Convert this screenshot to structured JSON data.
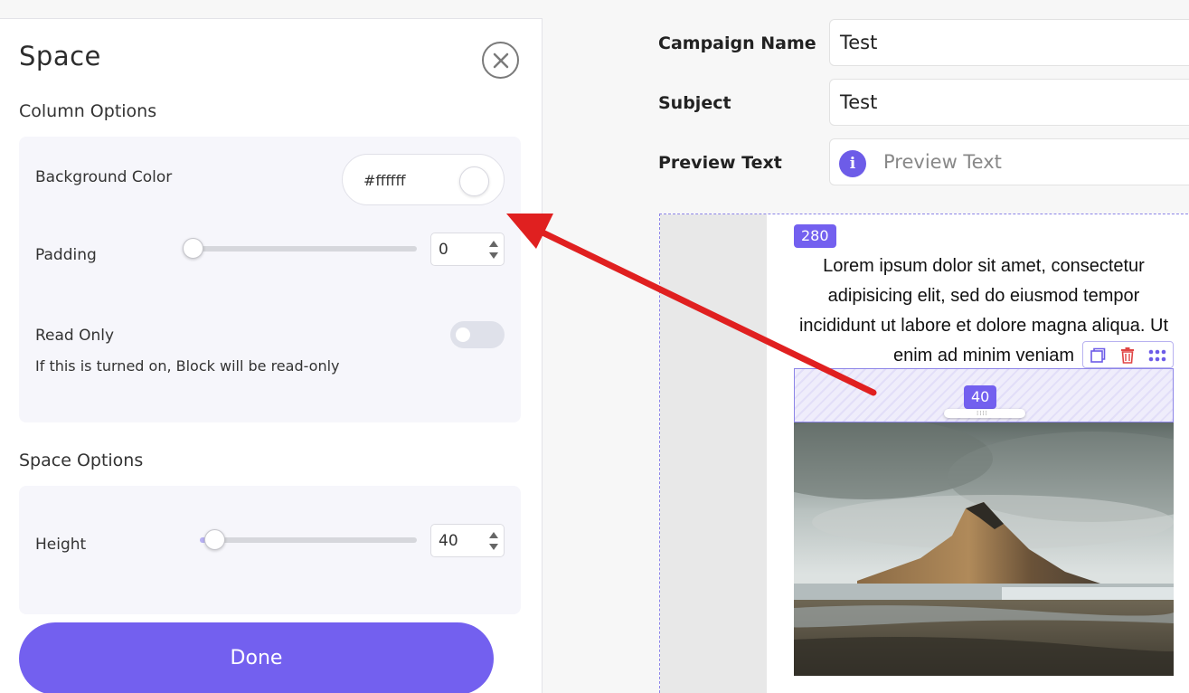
{
  "panel": {
    "title": "Space",
    "column_options": {
      "heading": "Column Options",
      "background_color": {
        "label": "Background Color",
        "value": "#ffffff"
      },
      "padding": {
        "label": "Padding",
        "value": "0",
        "level": 0
      },
      "read_only": {
        "label": "Read Only",
        "enabled": false,
        "hint": "If this is turned on, Block will be read-only"
      }
    },
    "space_options": {
      "heading": "Space Options",
      "height": {
        "label": "Height",
        "value": "40",
        "level": 0.04
      }
    },
    "done_label": "Done"
  },
  "form": {
    "campaign_name": {
      "label": "Campaign Name",
      "value": "Test"
    },
    "subject": {
      "label": "Subject",
      "value": "Test"
    },
    "preview_text": {
      "label": "Preview Text",
      "placeholder": "Preview Text"
    }
  },
  "canvas": {
    "column_width_badge": "280",
    "body_text": "Lorem ipsum dolor sit amet, consectetur adipisicing elit, sed do eiusmod tempor incididunt ut labore et dolore magna aliqua. Ut enim ad minim veniam",
    "space_height_badge": "40"
  },
  "icons": {
    "close": "close-icon",
    "info": "info-icon",
    "duplicate": "duplicate-icon",
    "delete": "trash-icon",
    "drag": "drag-dots-icon"
  },
  "colors": {
    "accent": "#7360ef",
    "annotation_arrow": "#e02020",
    "delete": "#e04545"
  }
}
